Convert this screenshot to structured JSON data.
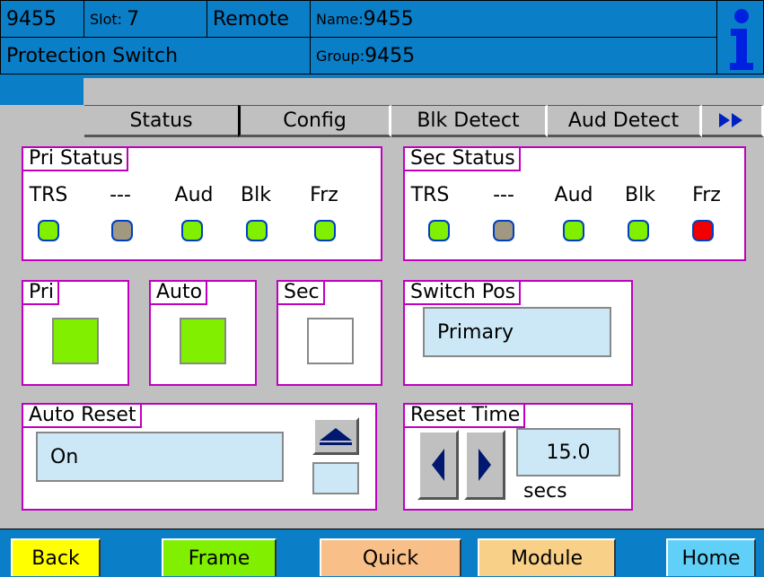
{
  "header": {
    "id": "9455",
    "slot_label": "Slot:",
    "slot_value": "7",
    "mode": "Remote",
    "name_label": "Name:",
    "name_value": "9455",
    "title": "Protection Switch",
    "group_label": "Group:",
    "group_value": "9455",
    "info_icon": "info-icon"
  },
  "tabs": [
    {
      "label": "Status",
      "selected": false
    },
    {
      "label": "Config",
      "selected": true
    },
    {
      "label": "Blk Detect",
      "selected": false
    },
    {
      "label": "Aud Detect",
      "selected": false
    }
  ],
  "tab_more_icon": "double-right-arrow-icon",
  "pri_status": {
    "title": "Pri Status",
    "labels": [
      "TRS",
      "---",
      "Aud",
      "Blk",
      "Frz"
    ],
    "leds": [
      "#80f000",
      "#a09880",
      "#80f000",
      "#80f000",
      "#80f000"
    ]
  },
  "sec_status": {
    "title": "Sec Status",
    "labels": [
      "TRS",
      "---",
      "Aud",
      "Blk",
      "Frz"
    ],
    "leds": [
      "#80f000",
      "#a09880",
      "#80f000",
      "#80f000",
      "#f00000"
    ]
  },
  "pri": {
    "title": "Pri",
    "active": true
  },
  "auto": {
    "title": "Auto",
    "active": true
  },
  "sec": {
    "title": "Sec",
    "active": false
  },
  "switch_pos": {
    "title": "Switch Pos",
    "value": "Primary"
  },
  "auto_reset": {
    "title": "Auto Reset",
    "value": "On",
    "up_icon": "up-arrow-icon"
  },
  "reset_time": {
    "title": "Reset Time",
    "value": "15.0",
    "unit": "secs",
    "left_icon": "left-arrow-icon",
    "right_icon": "right-arrow-icon"
  },
  "colors": {
    "header_bg": "#0a7ec6",
    "panel_border": "#c000c0",
    "active_green": "#80f000",
    "field_bg": "#cce8f6"
  },
  "footer": {
    "back": {
      "label": "Back",
      "color": "#ffff00"
    },
    "frame": {
      "label": "Frame",
      "color": "#80f000"
    },
    "quick": {
      "label": "Quick",
      "color": "#f8c088"
    },
    "module": {
      "label": "Module",
      "color": "#f8d088"
    },
    "home": {
      "label": "Home",
      "color": "#60d0f8"
    }
  }
}
